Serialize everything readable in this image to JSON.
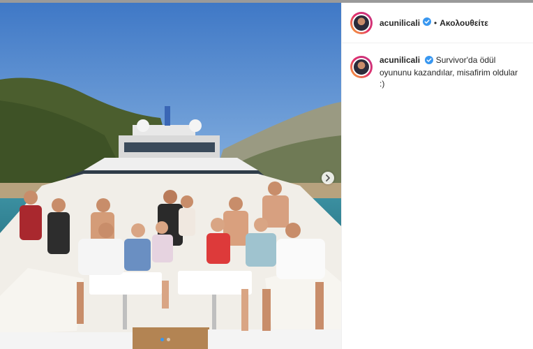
{
  "post": {
    "username": "acunilicali",
    "separator": "•",
    "follow_label": "Ακολουθείτε",
    "caption": "Survivor'da ödül oyununu kazandılar, misafirim oldular :)"
  },
  "carousel": {
    "slide_count": 2,
    "active_slide": 1
  },
  "colors": {
    "verified": "#3897f0",
    "text": "#262626",
    "border": "#efefef"
  },
  "icons": {
    "verified": "verified-badge-icon",
    "next": "chevron-right-icon"
  }
}
